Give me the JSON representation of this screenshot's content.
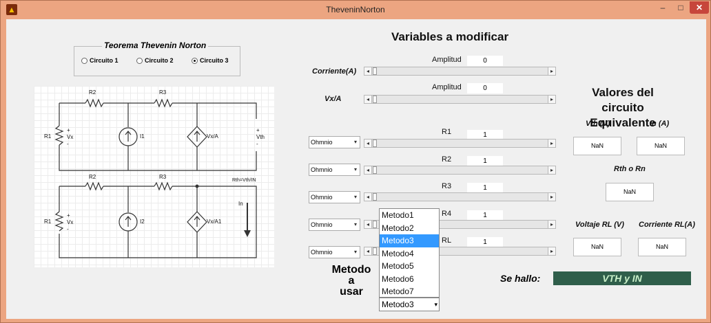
{
  "window": {
    "title": "TheveninNorton",
    "min": "–",
    "max": "□",
    "close": "✕"
  },
  "left_panel": {
    "panel_title": "Teorema Thevenin Norton",
    "radios": [
      {
        "label": "Circuito 1",
        "selected": false
      },
      {
        "label": "Circuito 2",
        "selected": false
      },
      {
        "label": "Circuito 3",
        "selected": true
      }
    ]
  },
  "circuit": {
    "top": {
      "R2": "R2",
      "R3": "R3",
      "R1": "R1",
      "plus1": "+",
      "vx": "Vx",
      "minus1": "-",
      "I1": "I1",
      "vxA": "Vx/A",
      "plus2": "+",
      "vth": "Vth",
      "minus2": "-"
    },
    "bottom": {
      "R2": "R2",
      "R3": "R3",
      "R1": "R1",
      "plus1": "+",
      "vx": "Vx",
      "minus1": "-",
      "I2": "I2",
      "vxA1": "Vx/A1",
      "rth": "Rth=Vth/IN",
      "in": "In"
    }
  },
  "variables": {
    "heading": "Variables a modificar",
    "corriente_label": "Corriente(A)",
    "amplitud1_label": "Amplitud",
    "amplitud1_value": "0",
    "vxa_label": "Vx/A",
    "amplitud2_label": "Amplitud",
    "amplitud2_value": "0",
    "rows": [
      {
        "unit": "Ohmnio",
        "name": "R1",
        "value": "1"
      },
      {
        "unit": "Ohmnio",
        "name": "R2",
        "value": "1"
      },
      {
        "unit": "Ohmnio",
        "name": "R3",
        "value": "1"
      },
      {
        "unit": "Ohmnio",
        "name": "R4",
        "value": "1"
      },
      {
        "unit": "Ohmnio",
        "name": "RL",
        "value": "1"
      }
    ]
  },
  "method": {
    "label_line1": "Metodo",
    "label_line2": "a",
    "label_line3": "usar",
    "options": [
      "Metodo1",
      "Metodo2",
      "Metodo3",
      "Metodo4",
      "Metodo5",
      "Metodo6",
      "Metodo7"
    ],
    "selected": "Metodo3"
  },
  "equivalent": {
    "heading_line1": "Valores del circuito",
    "heading_line2": "Equivalente",
    "vth_label": "Vth (V)",
    "vth_value": "NaN",
    "in_label": "In (A)",
    "in_value": "NaN",
    "rth_label": "Rth o Rn",
    "rth_value": "NaN",
    "vrl_label": "Voltaje RL (V)",
    "vrl_value": "NaN",
    "irl_label": "Corriente RL(A)",
    "irl_value": "NaN"
  },
  "result": {
    "label": "Se hallo:",
    "value": "VTH y IN",
    "color": "#2f5e4a"
  }
}
